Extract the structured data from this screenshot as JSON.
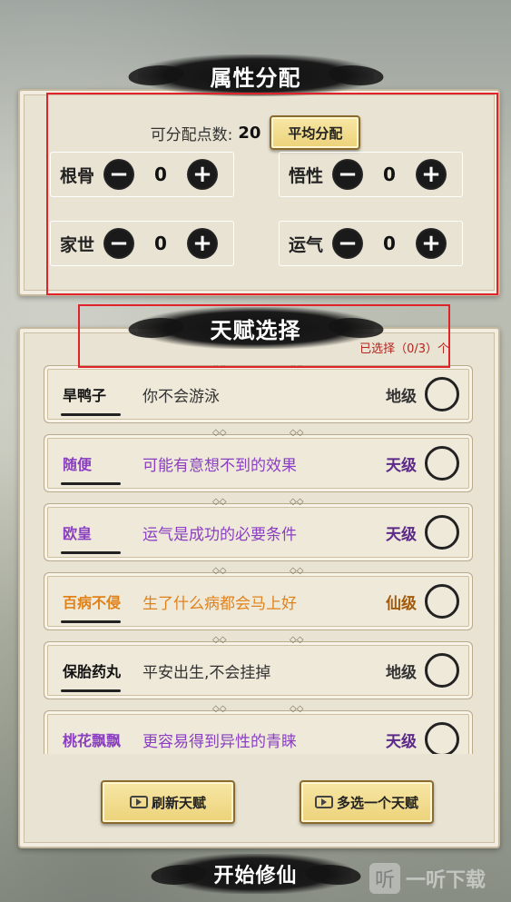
{
  "attributes_section": {
    "title": "属性分配",
    "points_label": "可分配点数:",
    "points_value": "20",
    "average_button": "平均分配",
    "attributes": [
      {
        "name": "根骨",
        "value": "0"
      },
      {
        "name": "悟性",
        "value": "0"
      },
      {
        "name": "家世",
        "value": "0"
      },
      {
        "name": "运气",
        "value": "0"
      }
    ],
    "minus_symbol": "−",
    "plus_symbol": "+"
  },
  "talent_section": {
    "title": "天赋选择",
    "selected_count": "已选择（0/3）个",
    "deco": "◇◇",
    "talents": [
      {
        "name": "旱鸭子",
        "desc": "你不会游泳",
        "tier": "地级",
        "color": "#111111"
      },
      {
        "name": "随便",
        "desc": "可能有意想不到的效果",
        "tier": "天级",
        "color": "#8a3fc0"
      },
      {
        "name": "欧皇",
        "desc": "运气是成功的必要条件",
        "tier": "天级",
        "color": "#8a3fc0"
      },
      {
        "name": "百病不侵",
        "desc": "生了什么病都会马上好",
        "tier": "仙级",
        "color": "#e0821a"
      },
      {
        "name": "保胎药丸",
        "desc": "平安出生,不会挂掉",
        "tier": "地级",
        "color": "#111111"
      },
      {
        "name": "桃花飘飘",
        "desc": "更容易得到异性的青睐",
        "tier": "天级",
        "color": "#8a3fc0"
      }
    ]
  },
  "buttons": {
    "refresh": "刷新天赋",
    "extra": "多选一个天赋",
    "start": "开始修仙"
  },
  "watermark": {
    "icon": "听",
    "text": "一听下载"
  },
  "colors": {
    "highlight_box": "#e0222a",
    "gold": "#ecd27a",
    "purple": "#8a3fc0",
    "orange": "#e0821a"
  }
}
